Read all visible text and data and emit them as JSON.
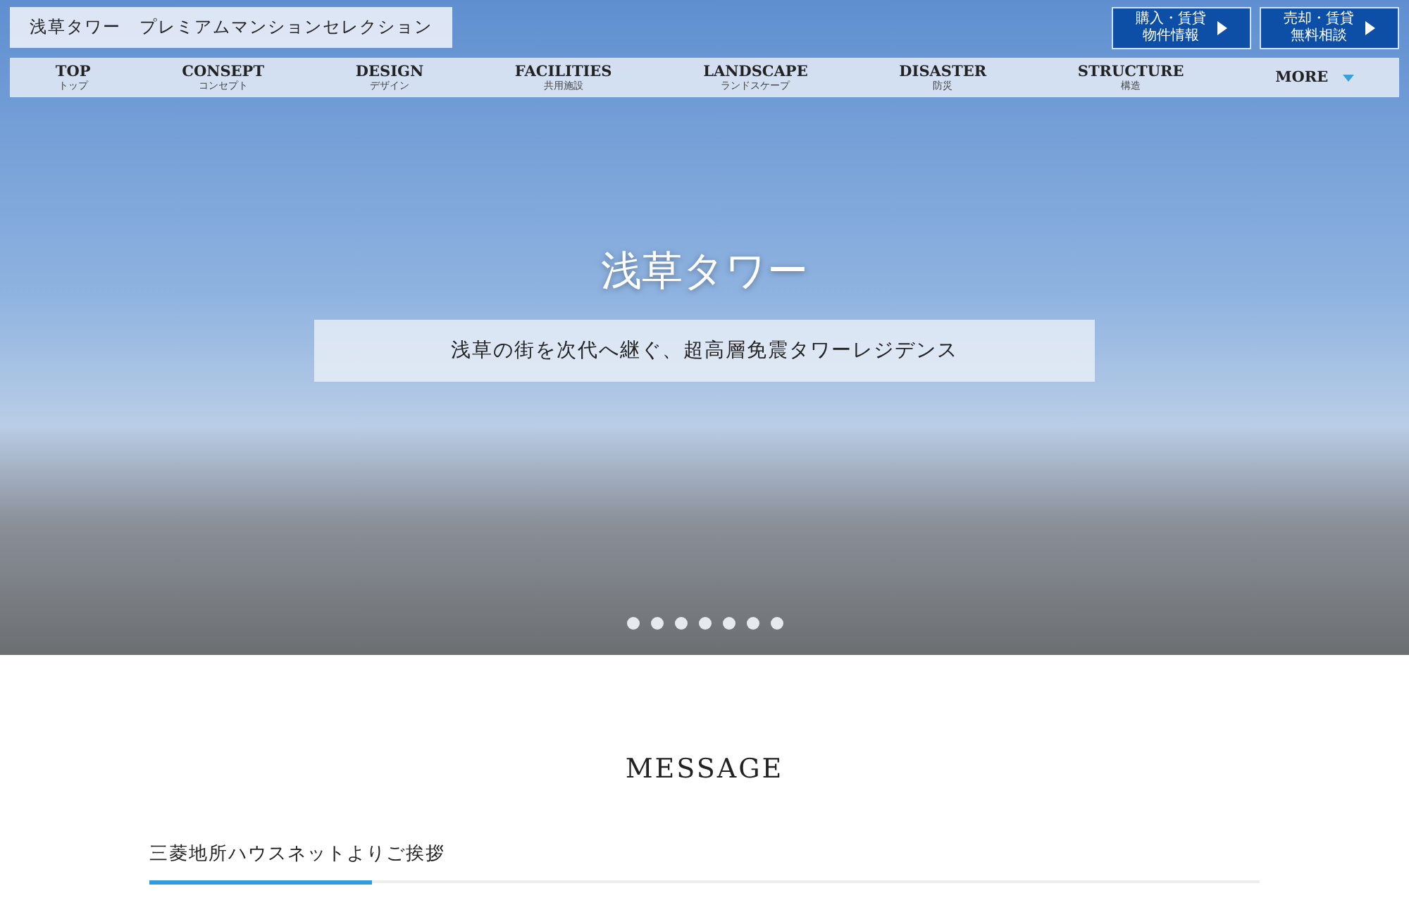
{
  "header": {
    "site_title": "浅草タワー　プレミアムマンションセレクション",
    "buttons": [
      {
        "lines": [
          "購入・賃貸",
          "物件情報"
        ]
      },
      {
        "lines": [
          "売却・賃貸",
          "無料相談"
        ]
      }
    ]
  },
  "nav": [
    {
      "label": "TOP",
      "sub": "トップ",
      "kind": "link"
    },
    {
      "label": "CONSEPT",
      "sub": "コンセプト",
      "kind": "link"
    },
    {
      "label": "DESIGN",
      "sub": "デザイン",
      "kind": "link"
    },
    {
      "label": "FACILITIES",
      "sub": "共用施設",
      "kind": "link"
    },
    {
      "label": "LANDSCAPE",
      "sub": "ランドスケープ",
      "kind": "link"
    },
    {
      "label": "DISASTER",
      "sub": "防災",
      "kind": "link"
    },
    {
      "label": "STRUCTURE",
      "sub": "構造",
      "kind": "link"
    },
    {
      "label": "MORE",
      "kind": "dropdown"
    }
  ],
  "hero": {
    "title": "浅草タワー",
    "tagline": "浅草の街を次代へ継ぐ、超高層免震タワーレジデンス",
    "slides": [
      {
        "selected": false
      },
      {
        "selected": false
      },
      {
        "selected": false
      },
      {
        "selected": false
      },
      {
        "selected": false
      },
      {
        "selected": false
      },
      {
        "selected": false
      }
    ]
  },
  "message": {
    "heading": "MESSAGE",
    "subheading": "三菱地所ハウスネットよりご挨拶"
  }
}
